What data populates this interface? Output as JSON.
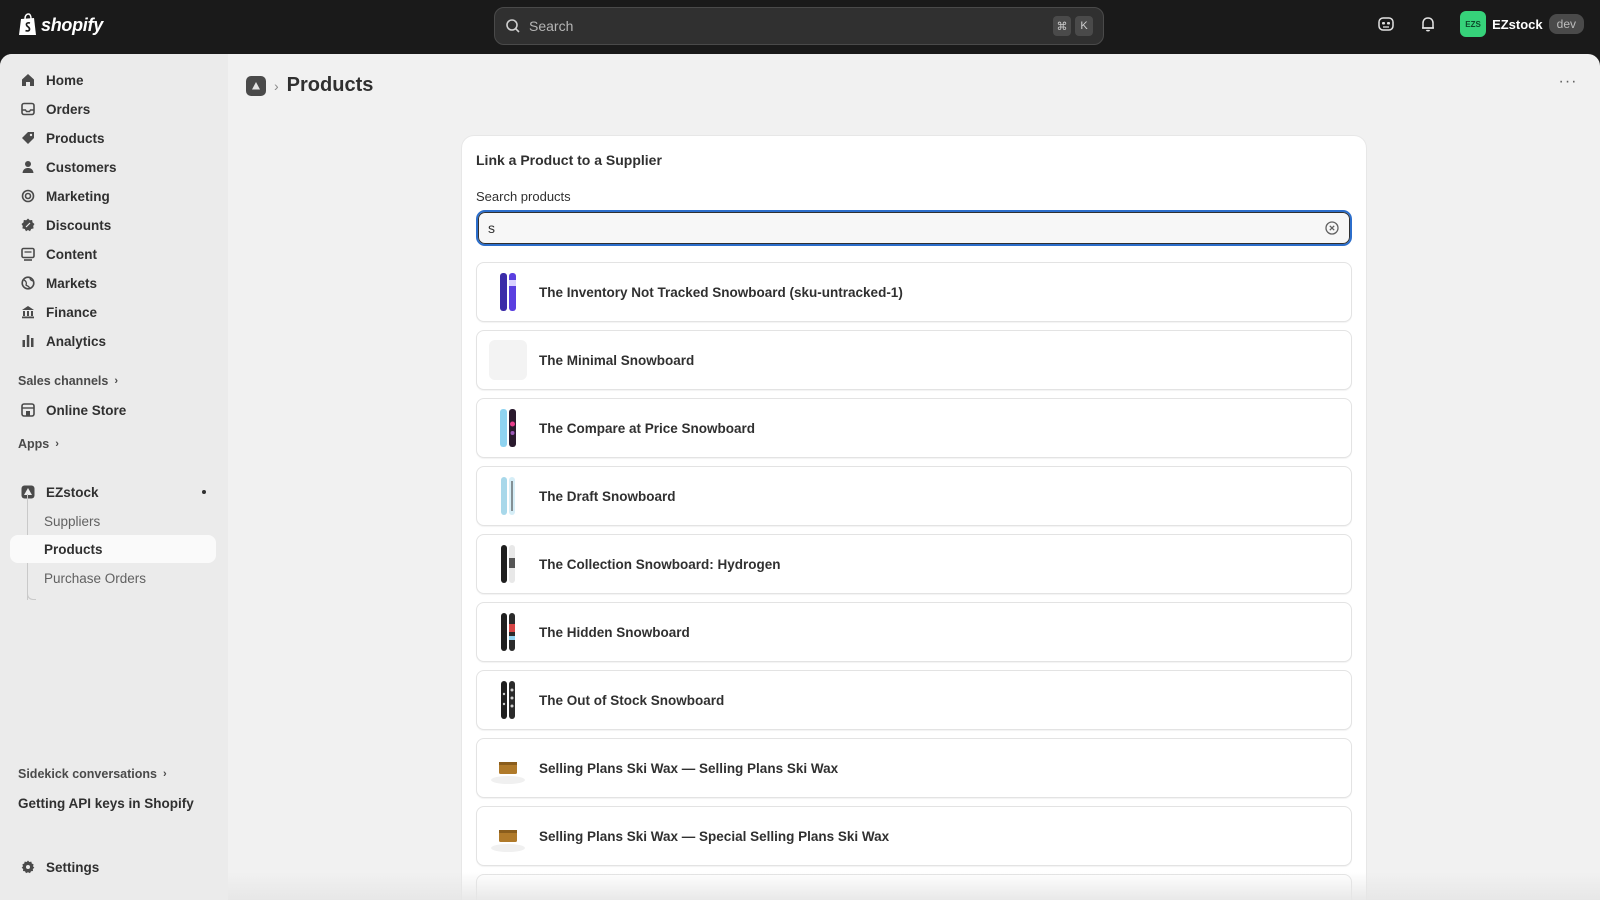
{
  "topbar": {
    "logo_text": "shopify",
    "search_placeholder": "Search",
    "shortcut_keys": [
      "⌘",
      "K"
    ],
    "store_initials": "EZS",
    "store_name": "EZstock",
    "store_badge": "dev"
  },
  "sidebar": {
    "nav": [
      {
        "label": "Home",
        "icon": "home-icon"
      },
      {
        "label": "Orders",
        "icon": "orders-icon"
      },
      {
        "label": "Products",
        "icon": "tag-icon"
      },
      {
        "label": "Customers",
        "icon": "person-icon"
      },
      {
        "label": "Marketing",
        "icon": "target-icon"
      },
      {
        "label": "Discounts",
        "icon": "discount-icon"
      },
      {
        "label": "Content",
        "icon": "content-icon"
      },
      {
        "label": "Markets",
        "icon": "globe-icon"
      },
      {
        "label": "Finance",
        "icon": "bank-icon"
      },
      {
        "label": "Analytics",
        "icon": "bar-chart-icon"
      }
    ],
    "sales_channels_label": "Sales channels",
    "online_store_label": "Online Store",
    "apps_label": "Apps",
    "app_name": "EZstock",
    "app_subitems": [
      "Suppliers",
      "Products",
      "Purchase Orders"
    ],
    "active_subitem": "Products",
    "sidekick_label": "Sidekick conversations",
    "sidekick_item": "Getting API keys in Shopify",
    "settings_label": "Settings"
  },
  "page": {
    "title": "Products",
    "card_title": "Link a Product to a Supplier",
    "search_label": "Search products",
    "search_value": "s",
    "results": [
      {
        "name": "The Inventory Not Tracked Snowboard (sku-untracked-1)",
        "thumb": "purple-snowboard"
      },
      {
        "name": "The Minimal Snowboard",
        "thumb": "blank"
      },
      {
        "name": "The Compare at Price Snowboard",
        "thumb": "blue-pink-snowboard"
      },
      {
        "name": "The Draft Snowboard",
        "thumb": "light-blue-snowboard"
      },
      {
        "name": "The Collection Snowboard: Hydrogen",
        "thumb": "black-white-snowboard"
      },
      {
        "name": "The Hidden Snowboard",
        "thumb": "black-red-snowboard"
      },
      {
        "name": "The Out of Stock Snowboard",
        "thumb": "black-pattern-snowboard"
      },
      {
        "name": "Selling Plans Ski Wax — Selling Plans Ski Wax",
        "thumb": "ski-wax"
      },
      {
        "name": "Selling Plans Ski Wax — Special Selling Plans Ski Wax",
        "thumb": "ski-wax"
      }
    ]
  },
  "colors": {
    "topbar": "#1a1a1a",
    "frame": "#f1f1f1",
    "sidebar": "#ebebeb",
    "focus_ring": "#2c6ecb",
    "avatar": "#36d27a"
  }
}
